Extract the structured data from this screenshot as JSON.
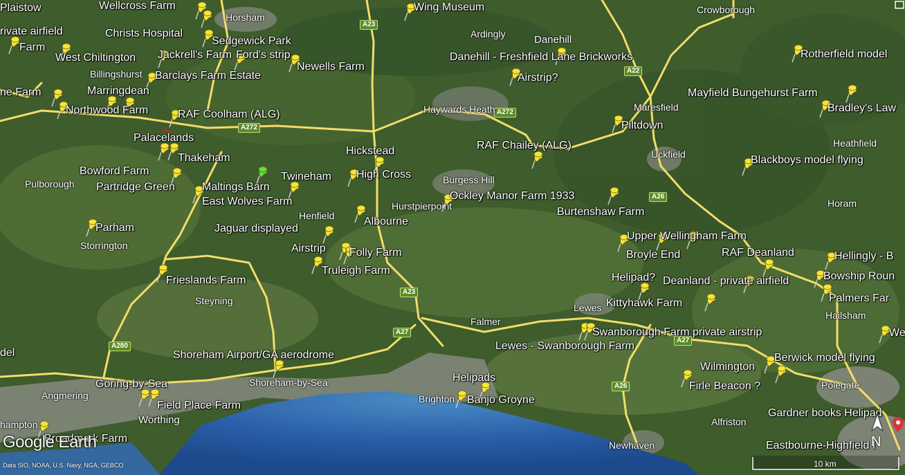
{
  "map": {
    "places": [
      {
        "id": "plaistow",
        "label": "Plaistow"
      },
      {
        "id": "wellcross",
        "label": "Wellcross Farm"
      },
      {
        "id": "wing-museum",
        "label": "Wing Museum"
      },
      {
        "id": "private-airfield-w",
        "label": "rivate airfield"
      },
      {
        "id": "christs-hospital",
        "label": "Christs Hospital"
      },
      {
        "id": "sedgewick-park",
        "label": "Sedgewick Park"
      },
      {
        "id": "farm-w",
        "label": "Farm"
      },
      {
        "id": "west-chiltington",
        "label": "West Chiltington"
      },
      {
        "id": "jackrells",
        "label": "Jackrell's Farm"
      },
      {
        "id": "fords-strip",
        "label": "Ford's strip"
      },
      {
        "id": "newells",
        "label": "Newells Farm"
      },
      {
        "id": "danehill-brickworks",
        "label": "Danehill - Freshfield Lane Brickworks"
      },
      {
        "id": "rotherfield",
        "label": "Rotherfield model"
      },
      {
        "id": "barclays",
        "label": "Barclays Farm Estate"
      },
      {
        "id": "airstrip-q",
        "label": "Airstrip?"
      },
      {
        "id": "ne-farm",
        "label": "ne Farm"
      },
      {
        "id": "marringdean",
        "label": "Marringdean"
      },
      {
        "id": "mayfield",
        "label": "Mayfield Bungehurst Farm"
      },
      {
        "id": "northwood",
        "label": "Northwood Farm"
      },
      {
        "id": "raf-coolham",
        "label": "RAF Coolham (ALG)"
      },
      {
        "id": "bradleys",
        "label": "Bradley's Law"
      },
      {
        "id": "piltdown",
        "label": "Piltdown"
      },
      {
        "id": "palacelands",
        "label": "Palacelands"
      },
      {
        "id": "raf-chailey",
        "label": "RAF Chailey (ALG)"
      },
      {
        "id": "thakeham",
        "label": "Thakeham"
      },
      {
        "id": "hickstead",
        "label": "Hickstead"
      },
      {
        "id": "blackboys",
        "label": "Blackboys model flying"
      },
      {
        "id": "bowford",
        "label": "Bowford Farm"
      },
      {
        "id": "twineham",
        "label": "Twineham"
      },
      {
        "id": "high-cross",
        "label": "High Cross"
      },
      {
        "id": "partridge-green",
        "label": "Partridge Green"
      },
      {
        "id": "maltings-barn",
        "label": "Maltings Barn"
      },
      {
        "id": "ockley-manor",
        "label": "Ockley Manor Farm 1933"
      },
      {
        "id": "east-wolves",
        "label": "East Wolves Farm"
      },
      {
        "id": "burtenshaw",
        "label": "Burtenshaw Farm"
      },
      {
        "id": "parham",
        "label": "Parham"
      },
      {
        "id": "albourne",
        "label": "Albourne"
      },
      {
        "id": "jaguar",
        "label": "Jaguar displayed"
      },
      {
        "id": "upper-wellingham",
        "label": "Upper Wellingham Farm"
      },
      {
        "id": "raf-deanland",
        "label": "RAF Deanland"
      },
      {
        "id": "broyle-end",
        "label": "Broyle End"
      },
      {
        "id": "hellingly",
        "label": "Hellingly - B"
      },
      {
        "id": "airstrip",
        "label": "Airstrip"
      },
      {
        "id": "folly-farm",
        "label": "Folly Farm"
      },
      {
        "id": "truleigh",
        "label": "Truleigh Farm"
      },
      {
        "id": "bowship",
        "label": "Bowship Roun"
      },
      {
        "id": "helipad-q",
        "label": "Helipad?"
      },
      {
        "id": "deanland-private",
        "label": "Deanland -  private airfield"
      },
      {
        "id": "frieslands",
        "label": "Frieslands Farm"
      },
      {
        "id": "palmers",
        "label": "Palmers Far"
      },
      {
        "id": "kittyhawk",
        "label": "Kittyhawk Farm"
      },
      {
        "id": "swanborough-private",
        "label": "Swanborough Farm private airstrip"
      },
      {
        "id": "lewes-swanborough",
        "label": "Lewes - Swanborough Farm"
      },
      {
        "id": "we",
        "label": "We"
      },
      {
        "id": "shoreham-airport",
        "label": "Shoreham Airport/GA aerodrome"
      },
      {
        "id": "berwick",
        "label": "Berwick model flying"
      },
      {
        "id": "wilmington",
        "label": "Wilmington"
      },
      {
        "id": "helipads",
        "label": "Helipads"
      },
      {
        "id": "goring",
        "label": "Goring-by-Sea"
      },
      {
        "id": "firle",
        "label": "Firle Beacon ?"
      },
      {
        "id": "banjo",
        "label": "Banjo Groyne"
      },
      {
        "id": "field-place",
        "label": "Field Place Farm"
      },
      {
        "id": "gardner",
        "label": "Gardner books Helipad"
      },
      {
        "id": "broadmark",
        "label": "Broadmark Farm"
      },
      {
        "id": "eastbourne",
        "label": "Eastbourne-Highfield I"
      },
      {
        "id": "del",
        "label": "del"
      }
    ],
    "towns": [
      {
        "id": "horsham",
        "label": "Horsham"
      },
      {
        "id": "ardingly",
        "label": "Ardingly"
      },
      {
        "id": "danehill",
        "label": "Danehill"
      },
      {
        "id": "crowborough",
        "label": "Crowborough"
      },
      {
        "id": "billingshurst",
        "label": "Billingshurst"
      },
      {
        "id": "haywards-heath",
        "label": "Haywards Heath"
      },
      {
        "id": "maresfield",
        "label": "Maresfield"
      },
      {
        "id": "uckfield",
        "label": "Uckfield"
      },
      {
        "id": "heathfield",
        "label": "Heathfield"
      },
      {
        "id": "burgess-hill",
        "label": "Burgess Hill"
      },
      {
        "id": "pulborough",
        "label": "Pulborough"
      },
      {
        "id": "hurstpierpoint",
        "label": "Hurstpierpoint"
      },
      {
        "id": "horam",
        "label": "Horam"
      },
      {
        "id": "henfield",
        "label": "Henfield"
      },
      {
        "id": "storrington",
        "label": "Storrington"
      },
      {
        "id": "steyning",
        "label": "Steyning"
      },
      {
        "id": "lewes",
        "label": "Lewes"
      },
      {
        "id": "hailsham",
        "label": "Hailsham"
      },
      {
        "id": "falmer",
        "label": "Falmer"
      },
      {
        "id": "shoreham-by-sea",
        "label": "Shoreham-by-Sea"
      },
      {
        "id": "angmering",
        "label": "Angmering"
      },
      {
        "id": "polegate",
        "label": "Polegate"
      },
      {
        "id": "worthing",
        "label": "Worthing"
      },
      {
        "id": "brighton",
        "label": "Brighton"
      },
      {
        "id": "alfriston",
        "label": "Alfriston"
      },
      {
        "id": "hampton",
        "label": "hampton"
      },
      {
        "id": "newhaven",
        "label": "Newhaven"
      }
    ],
    "roads": [
      {
        "id": "a23-n",
        "label": "A23"
      },
      {
        "id": "a22",
        "label": "A22"
      },
      {
        "id": "a272-w",
        "label": "A272"
      },
      {
        "id": "a272-e",
        "label": "A272"
      },
      {
        "id": "a26-n",
        "label": "A26"
      },
      {
        "id": "a23-s",
        "label": "A23"
      },
      {
        "id": "a27-w",
        "label": "A27"
      },
      {
        "id": "a280",
        "label": "A280"
      },
      {
        "id": "a27-e",
        "label": "A27"
      },
      {
        "id": "a26-s",
        "label": "A26"
      }
    ],
    "colors": {
      "pin_yellow": "#f4e53a",
      "pin_green": "#5fe03a",
      "road": "#f2dd6a",
      "sea_deep": "#1f4f9a",
      "sea_shallow": "#3d79b8",
      "land_dark": "#2f4a22",
      "land_light": "#5a7a3c",
      "urban": "#8a8a86"
    }
  },
  "overlay": {
    "logo": "Google Earth",
    "credit": "Data SIO, NOAA, U.S. Navy, NGA, GEBCO",
    "scale_label": "10 km",
    "compass_label": "N"
  }
}
